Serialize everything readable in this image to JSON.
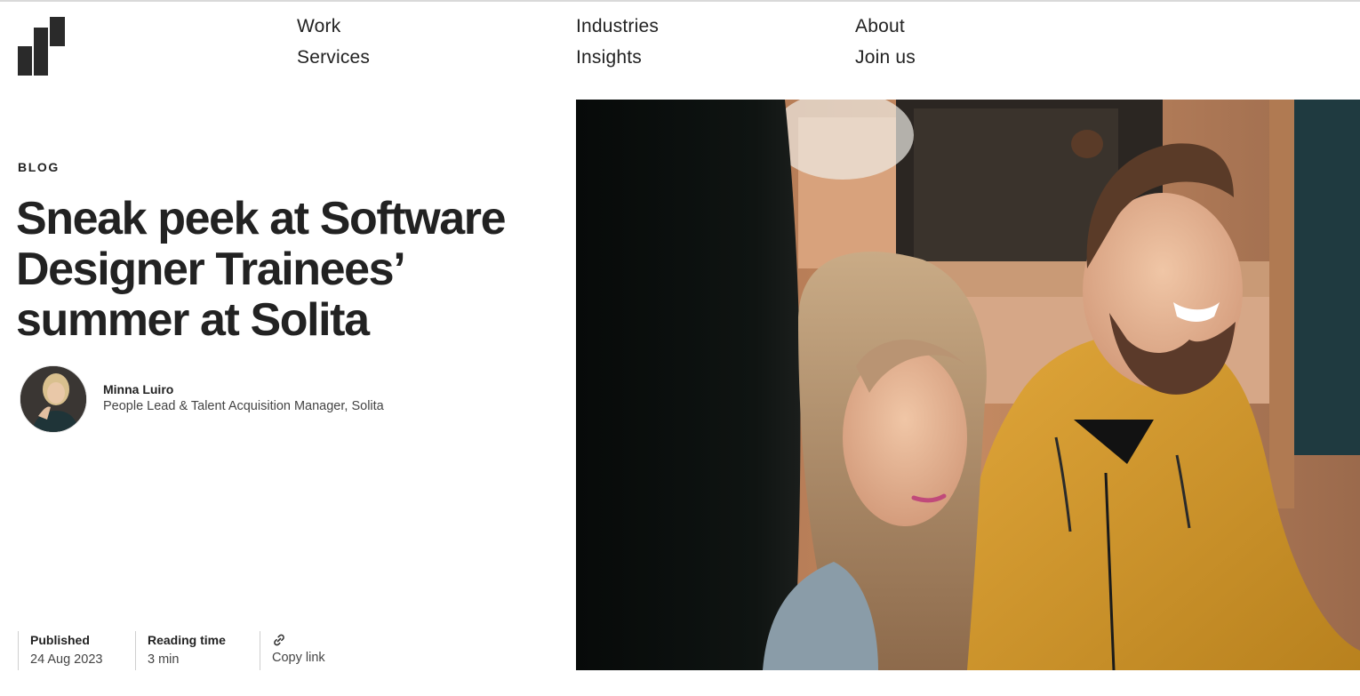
{
  "site": {
    "logo_icon": "solita-logo-icon"
  },
  "nav": {
    "items": [
      {
        "label": "Work"
      },
      {
        "label": "Industries"
      },
      {
        "label": "About"
      },
      {
        "label": "Services"
      },
      {
        "label": "Insights"
      },
      {
        "label": "Join us"
      }
    ]
  },
  "article": {
    "category": "BLOG",
    "title": "Sneak peek at Software Designer Trainees’ summer at Solita",
    "author": {
      "name": "Minna Luiro",
      "role": "People Lead & Talent Acquisition Manager, Solita"
    },
    "meta": {
      "published_label": "Published",
      "published_value": "24 Aug 2023",
      "reading_label": "Reading time",
      "reading_value": "3 min",
      "copy_link_label": "Copy link",
      "copy_link_icon": "link-icon"
    }
  },
  "colors": {
    "text": "#222222",
    "rule": "#cfcfcf",
    "hoodie": "#d69a2c"
  }
}
